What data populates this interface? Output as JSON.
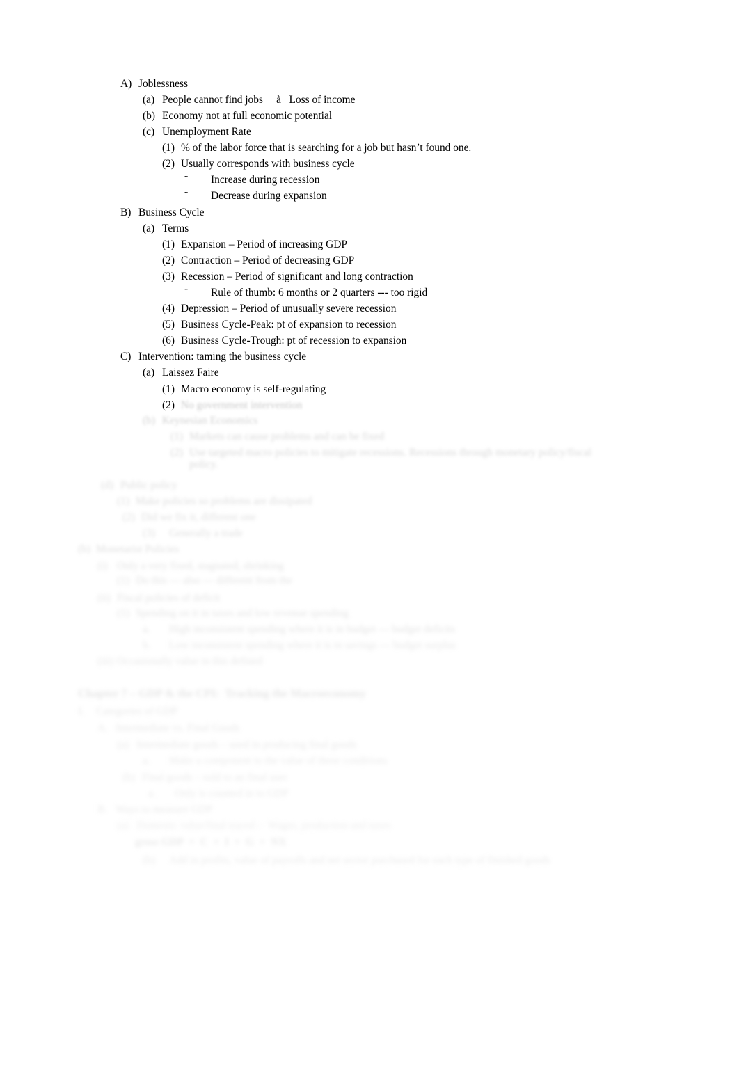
{
  "document": {
    "type": "outline-notes",
    "page_background": "#ffffff",
    "text_color": "#000000",
    "note": "Scanned handout of macroeconomics outline notes; lower portion of the page fades and blurs into illegibility."
  },
  "glyphs": {
    "broken_arrow": "à",
    "broken_bullet": "¨"
  },
  "outline": [
    {
      "id": "A",
      "marker": "A)",
      "level": "A",
      "text": "Joblessness",
      "legibility": "clear",
      "children": [
        {
          "marker": "(a)",
          "level": "a",
          "text": "People cannot find jobs     à   Loss of income",
          "legibility": "clear"
        },
        {
          "marker": "(b)",
          "level": "a",
          "text": "Economy not at full economic potential",
          "legibility": "clear"
        },
        {
          "marker": "(c)",
          "level": "a",
          "text": "Unemployment Rate",
          "legibility": "clear",
          "children": [
            {
              "marker": "(1)",
              "level": "1",
              "text": "% of the labor force that is searching for a job but hasn’t found one.",
              "legibility": "clear"
            },
            {
              "marker": "(2)",
              "level": "1",
              "text": "Usually corresponds with business cycle",
              "legibility": "clear",
              "children": [
                {
                  "marker": "¨",
                  "level": "b",
                  "text": "Increase during recession",
                  "legibility": "clear"
                },
                {
                  "marker": "¨",
                  "level": "b",
                  "text": "Decrease during expansion",
                  "legibility": "clear"
                }
              ]
            }
          ]
        }
      ]
    },
    {
      "id": "B",
      "marker": "B)",
      "level": "A",
      "text": "Business Cycle",
      "legibility": "clear",
      "children": [
        {
          "marker": "(a)",
          "level": "a",
          "text": "Terms",
          "legibility": "clear",
          "children": [
            {
              "marker": "(1)",
              "level": "1",
              "text": "Expansion – Period of increasing GDP",
              "legibility": "clear"
            },
            {
              "marker": "(2)",
              "level": "1",
              "text": "Contraction – Period of decreasing GDP",
              "legibility": "clear"
            },
            {
              "marker": "(3)",
              "level": "1",
              "text": "Recession – Period of significant and long contraction",
              "legibility": "clear",
              "children": [
                {
                  "marker": "¨",
                  "level": "b",
                  "text": "Rule of thumb: 6 months or 2 quarters --- too rigid",
                  "legibility": "clear"
                }
              ]
            },
            {
              "marker": "(4)",
              "level": "1",
              "text": "Depression – Period of unusually severe recession",
              "legibility": "clear"
            },
            {
              "marker": "(5)",
              "level": "1",
              "text": "Business Cycle-Peak: pt of expansion to recession",
              "legibility": "clear"
            },
            {
              "marker": "(6)",
              "level": "1",
              "text": "Business Cycle-Trough: pt of recession to expansion",
              "legibility": "clear"
            }
          ]
        }
      ]
    },
    {
      "id": "C",
      "marker": "C)",
      "level": "A",
      "text": "Intervention: taming the business cycle",
      "legibility": "clear",
      "children": [
        {
          "marker": "(a)",
          "level": "a",
          "text": "Laissez Faire",
          "legibility": "clear",
          "children": [
            {
              "marker": "(1)",
              "level": "1",
              "text": "Macro economy is self-regulating",
              "legibility": "clear"
            },
            {
              "marker": "(2)",
              "level": "1",
              "text": "No government intervention",
              "legibility": "faded"
            }
          ]
        },
        {
          "marker": "(b)",
          "level": "a",
          "text": "Keynesian Economics",
          "legibility": "faded",
          "children": [
            {
              "marker": "(1)",
              "level": "1",
              "text": "Markets can cause problems and can be fixed",
              "legibility": "faded"
            },
            {
              "marker": "(2)",
              "level": "1",
              "text": "Use targeted macro policies to mitigate recessions. Recessions through monetary policy/fiscal policy.",
              "legibility": "faded"
            }
          ]
        }
      ]
    },
    {
      "id": "D",
      "marker": "(d)",
      "level": "a",
      "text": "Public policy",
      "legibility": "faded",
      "children": [
        {
          "marker": "(1)",
          "level": "1",
          "text": "Make policies so problems are dissipated",
          "legibility": "faded"
        },
        {
          "marker": "(2)",
          "level": "1",
          "text": "Did we fix it, different one",
          "legibility": "faded"
        },
        {
          "marker": "(3)",
          "level": "1",
          "text": "Generally a trade",
          "legibility": "faded"
        }
      ]
    },
    {
      "id": "E",
      "marker": "(b)",
      "level": "root",
      "text": "Monetarist Policies",
      "legibility": "faded",
      "children": [
        {
          "marker": "(i)",
          "level": "a",
          "text": "Only a very fixed, stagnated, shrinking",
          "legibility": "faded",
          "children": [
            {
              "marker": "(1)",
              "level": "1",
              "text": "Do this --- also --- different from the",
              "legibility": "faded"
            }
          ]
        },
        {
          "marker": "(ii)",
          "level": "a",
          "text": "Fiscal policies of deficit",
          "legibility": "faded",
          "children": [
            {
              "marker": "(1)",
              "level": "1",
              "text": "Spending on it in taxes and low revenue spending",
              "legibility": "faded",
              "children": [
                {
                  "marker": "a.",
                  "level": "b",
                  "text": "High inconsistent spending where it is in budget --- budget deficits",
                  "legibility": "faded"
                },
                {
                  "marker": "b.",
                  "level": "b",
                  "text": "Low inconsistent spending where it is in savings --- budget surplus",
                  "legibility": "faded"
                }
              ]
            }
          ]
        },
        {
          "marker": "(iii)",
          "level": "a",
          "text": "Occasionally value in this defined",
          "legibility": "faded"
        }
      ]
    }
  ],
  "chapter_heading": {
    "text": "Chapter 7 – GDP & the CPI:  Tracking the Macroeconomy",
    "bold": true,
    "legibility": "faded-illegible"
  },
  "chapter_outline": [
    {
      "marker": "I.",
      "level": "root",
      "text": "Categories of GDP",
      "legibility": "faded"
    },
    {
      "marker": "A.",
      "level": "A",
      "text": "Intermediate vs. Final Goods",
      "legibility": "faded",
      "children": [
        {
          "marker": "(a)",
          "level": "a",
          "text": "Intermediate goods – used in producing final goods",
          "legibility": "faded",
          "children": [
            {
              "marker": "a.",
              "level": "b",
              "text": "Make a component to the value of these conditions",
              "legibility": "faded"
            }
          ]
        },
        {
          "marker": "(b)",
          "level": "a",
          "text": "Final goods – sold to an final user",
          "legibility": "faded",
          "children": [
            {
              "marker": "a.",
              "level": "b",
              "text": "Only is counted in to GDP",
              "legibility": "faded"
            }
          ]
        }
      ]
    },
    {
      "marker": "B.",
      "level": "A",
      "text": "Ways to measure GDP",
      "legibility": "faded",
      "children": [
        {
          "marker": "(a)",
          "level": "a",
          "text": "Domestic value/final traced –  Wages, production and taxes",
          "legibility": "faded",
          "equation": "gross GDP  =  C  +  I  +  G  +  NX",
          "equation_bold": true
        },
        {
          "marker": "(b)",
          "level": "a",
          "text": "Add in profits, value of payrolls and net sector purchased for each type of finished goods",
          "legibility": "faded"
        }
      ]
    }
  ]
}
